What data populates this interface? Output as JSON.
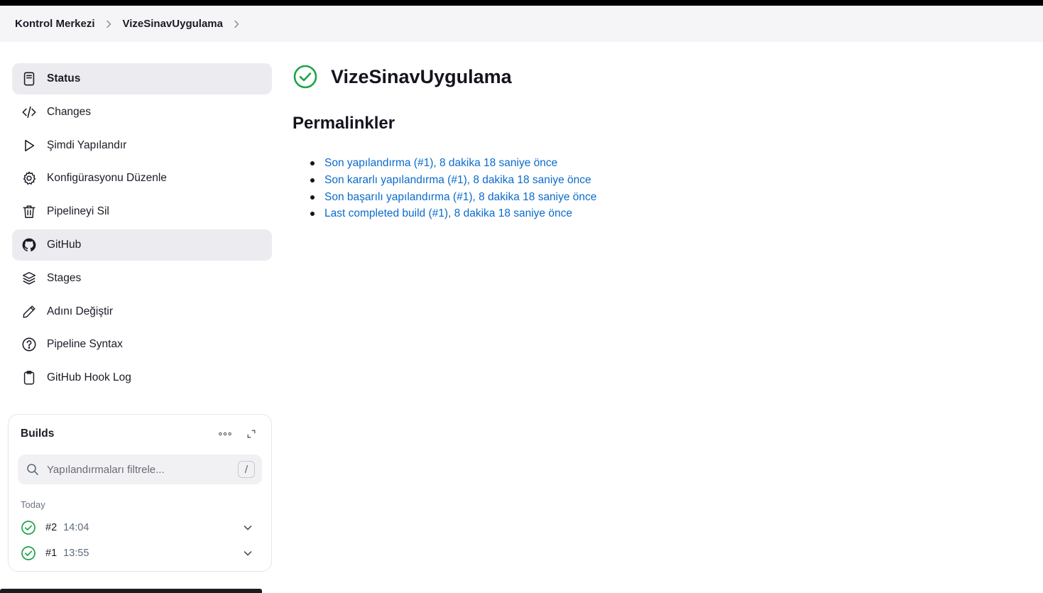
{
  "breadcrumb": {
    "items": [
      "Kontrol Merkezi",
      "VizeSinavUygulama"
    ]
  },
  "sidebar": {
    "items": [
      {
        "label": "Status",
        "icon": "document-icon",
        "active": true
      },
      {
        "label": "Changes",
        "icon": "code-icon"
      },
      {
        "label": "Şimdi Yapılandır",
        "icon": "play-icon"
      },
      {
        "label": "Konfigürasyonu Düzenle",
        "icon": "gear-icon"
      },
      {
        "label": "Pipelineyi Sil",
        "icon": "trash-icon"
      },
      {
        "label": "GitHub",
        "icon": "github-icon",
        "active": true
      },
      {
        "label": "Stages",
        "icon": "layers-icon"
      },
      {
        "label": "Adını Değiştir",
        "icon": "pencil-icon"
      },
      {
        "label": "Pipeline Syntax",
        "icon": "help-circle-icon"
      },
      {
        "label": "GitHub Hook Log",
        "icon": "clipboard-icon"
      }
    ]
  },
  "builds": {
    "title": "Builds",
    "filter_placeholder": "Yapılandırmaları filtrele...",
    "shortcut": "/",
    "group": "Today",
    "rows": [
      {
        "number": "#2",
        "time": "14:04",
        "status": "success"
      },
      {
        "number": "#1",
        "time": "13:55",
        "status": "success"
      }
    ]
  },
  "main": {
    "title": "VizeSinavUygulama",
    "status": "success",
    "permalinks_heading": "Permalinkler",
    "permalinks": [
      "Son yapılandırma (#1), 8 dakika 18 saniye önce",
      "Son kararlı yapılandırma (#1), 8 dakika 18 saniye önce",
      "Son başarılı yapılandırma (#1), 8 dakika 18 saniye önce",
      "Last completed build (#1), 8 dakika 18 saniye önce"
    ]
  },
  "colors": {
    "success": "#1ea446",
    "link": "#0b6bcb",
    "active_bg": "#ececf0"
  }
}
